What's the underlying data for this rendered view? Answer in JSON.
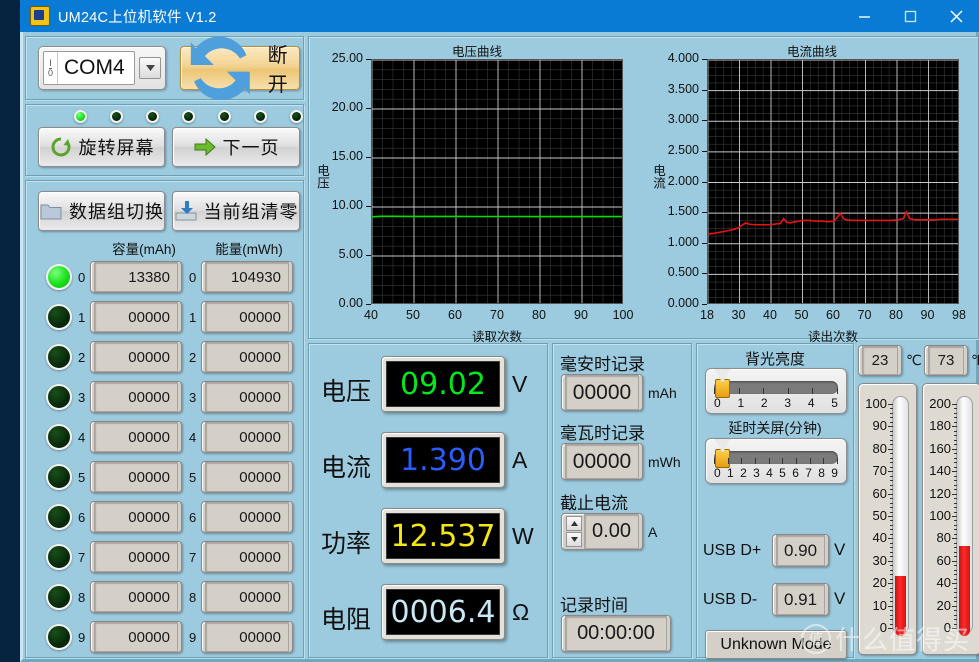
{
  "window": {
    "title": "UM24C上位机软件 V1.2",
    "icon": "app-icon",
    "minimize": "—",
    "maximize": "▢",
    "close": "✕",
    "titlebar_color": "#0a7bd4",
    "background_color": "#9ccbdf"
  },
  "connection": {
    "port_label": "I/O",
    "port_value": "COM4",
    "dropdown_arrow": "▾",
    "disconnect_button": "断开"
  },
  "page_leds": {
    "count": 7,
    "active_index": 0
  },
  "actions": {
    "rotate_screen": "旋转屏幕",
    "next_page": "下一页",
    "switch_group": "数据组切换",
    "clear_group": "当前组清零"
  },
  "groups": {
    "capacity_header": "容量(mAh)",
    "energy_header": "能量(mWh)",
    "rows": [
      {
        "index": "0",
        "active": true,
        "capacity": "13380",
        "energy": "104930"
      },
      {
        "index": "1",
        "active": false,
        "capacity": "00000",
        "energy": "00000"
      },
      {
        "index": "2",
        "active": false,
        "capacity": "00000",
        "energy": "00000"
      },
      {
        "index": "3",
        "active": false,
        "capacity": "00000",
        "energy": "00000"
      },
      {
        "index": "4",
        "active": false,
        "capacity": "00000",
        "energy": "00000"
      },
      {
        "index": "5",
        "active": false,
        "capacity": "00000",
        "energy": "00000"
      },
      {
        "index": "6",
        "active": false,
        "capacity": "00000",
        "energy": "00000"
      },
      {
        "index": "7",
        "active": false,
        "capacity": "00000",
        "energy": "00000"
      },
      {
        "index": "8",
        "active": false,
        "capacity": "00000",
        "energy": "00000"
      },
      {
        "index": "9",
        "active": false,
        "capacity": "00000",
        "energy": "00000"
      }
    ]
  },
  "chart_data": [
    {
      "type": "line",
      "name": "voltage-chart",
      "title": "电压曲线",
      "xlabel": "读取次数",
      "ylabel": "电压",
      "xlim": [
        40,
        100
      ],
      "ylim": [
        0.0,
        25.0
      ],
      "xticks": [
        "40",
        "50",
        "60",
        "70",
        "80",
        "90",
        "100"
      ],
      "yticks": [
        "0.00",
        "5.00",
        "10.00",
        "15.00",
        "20.00",
        "25.00"
      ],
      "grid": true,
      "plot_bg": "#000000",
      "series": [
        {
          "name": "电压",
          "color": "#00e000",
          "x": [
            40,
            42,
            45,
            50,
            55,
            60,
            65,
            70,
            75,
            80,
            85,
            90,
            95,
            100
          ],
          "values": [
            9.0,
            9.05,
            9.05,
            9.04,
            9.04,
            9.04,
            9.03,
            9.03,
            9.03,
            9.02,
            9.02,
            9.02,
            9.02,
            9.02
          ]
        }
      ]
    },
    {
      "type": "line",
      "name": "current-chart",
      "title": "电流曲线",
      "xlabel": "读出次数",
      "ylabel": "电流",
      "xlim": [
        18,
        98
      ],
      "ylim": [
        0.0,
        4.0
      ],
      "xticks": [
        "18",
        "30",
        "40",
        "50",
        "60",
        "70",
        "80",
        "90",
        "98"
      ],
      "yticks": [
        "0.000",
        "0.500",
        "1.000",
        "1.500",
        "2.000",
        "2.500",
        "3.000",
        "3.500",
        "4.000"
      ],
      "grid": true,
      "plot_bg": "#000000",
      "series": [
        {
          "name": "电流",
          "color": "#e81414",
          "x": [
            18,
            20,
            22,
            24,
            26,
            28,
            29,
            30,
            31,
            33,
            35,
            37,
            39,
            41,
            42,
            43,
            44,
            46,
            48,
            50,
            52,
            54,
            56,
            58,
            59,
            60,
            61,
            62,
            64,
            66,
            68,
            70,
            72,
            74,
            76,
            78,
            80,
            81,
            82,
            84,
            86,
            88,
            90,
            92,
            94,
            96,
            98
          ],
          "values": [
            1.16,
            1.17,
            1.19,
            1.21,
            1.23,
            1.27,
            1.31,
            1.34,
            1.32,
            1.31,
            1.31,
            1.31,
            1.32,
            1.33,
            1.41,
            1.35,
            1.34,
            1.36,
            1.38,
            1.38,
            1.37,
            1.37,
            1.36,
            1.37,
            1.43,
            1.5,
            1.41,
            1.39,
            1.38,
            1.38,
            1.38,
            1.38,
            1.38,
            1.38,
            1.38,
            1.39,
            1.41,
            1.52,
            1.41,
            1.39,
            1.39,
            1.39,
            1.39,
            1.4,
            1.4,
            1.4,
            1.4
          ]
        }
      ]
    }
  ],
  "readouts": [
    {
      "name": "voltage",
      "label": "电压",
      "value": "09.02",
      "unit": "V",
      "color": "#00e81e"
    },
    {
      "name": "current",
      "label": "电流",
      "value": "1.390",
      "unit": "A",
      "color": "#2b5cff"
    },
    {
      "name": "power",
      "label": "功率",
      "value": "12.537",
      "unit": "W",
      "color": "#f5e616"
    },
    {
      "name": "resistance",
      "label": "电阻",
      "value": "0006.4",
      "unit": "Ω",
      "color": "#c9e8f5"
    }
  ],
  "records": {
    "mah_label": "毫安时记录",
    "mah_value": "00000",
    "mah_unit": "mAh",
    "mwh_label": "毫瓦时记录",
    "mwh_value": "00000",
    "mwh_unit": "mWh",
    "cutoff_label": "截止电流",
    "cutoff_value": "0.00",
    "cutoff_unit": "A",
    "spin_up": "▲",
    "spin_down": "▼",
    "time_label": "记录时间",
    "time_value": "00:00:00"
  },
  "backlight": {
    "brightness_label": "背光亮度",
    "brightness_value": 0,
    "brightness_ticks": [
      "0",
      "1",
      "2",
      "3",
      "4",
      "5"
    ],
    "timeout_label": "延时关屏(分钟)",
    "timeout_value": 0,
    "timeout_ticks": [
      "0",
      "1",
      "2",
      "3",
      "4",
      "5",
      "6",
      "7",
      "8",
      "9"
    ]
  },
  "usb": {
    "dplus_label": "USB D+",
    "dplus_value": "0.90",
    "dplus_unit": "V",
    "dminus_label": "USB D-",
    "dminus_value": "0.91",
    "dminus_unit": "V",
    "mode": "Unknown Mode"
  },
  "temperature": {
    "celsius_value": "23",
    "celsius_unit": "℃",
    "fahrenheit_value": "73",
    "fahrenheit_unit": "℉",
    "celsius_ticks": [
      "100",
      "90",
      "80",
      "70",
      "60",
      "50",
      "40",
      "30",
      "20",
      "10",
      "0"
    ],
    "fahrenheit_ticks": [
      "200",
      "180",
      "160",
      "140",
      "120",
      "100",
      "80",
      "60",
      "40",
      "20",
      "0"
    ],
    "celsius_range": [
      0,
      100
    ],
    "fahrenheit_range": [
      0,
      200
    ]
  },
  "watermark": {
    "logo": "zhi-logo",
    "text": "什么值得买"
  }
}
